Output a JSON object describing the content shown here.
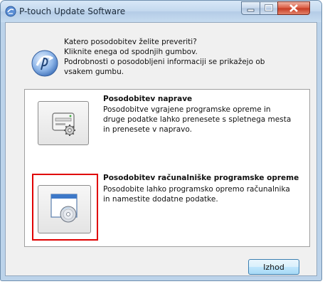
{
  "window": {
    "title": "P-touch Update Software",
    "icon": "ptouch-app-icon",
    "controls": [
      "minimize-icon",
      "maximize-icon",
      "close-icon"
    ]
  },
  "intro": {
    "icon": "ptouch-logo-icon",
    "lines": [
      "Katero posodobitev želite preveriti?",
      "Kliknite enega od spodnjih gumbov.",
      "Podrobnosti o posodobljeni informaciji se prikažejo ob",
      "vsakem gumbu."
    ]
  },
  "options": [
    {
      "title": "Posodobitev naprave",
      "icon": "printer-gear-icon",
      "description": [
        "Posodobitve vgrajene programske opreme in",
        "druge podatke lahko prenesete s spletnega mesta",
        "in prenesete v napravo."
      ]
    },
    {
      "title": "Posodobitev računalniške programske opreme",
      "icon": "window-disc-icon",
      "highlighted": true,
      "description": [
        "Posodobite lahko programsko opremo računalnika",
        "in namestite dodatne podatke."
      ]
    }
  ],
  "footer": {
    "exit_label": "Izhod"
  },
  "colors": {
    "highlight": "#e00000",
    "close_button": "#c63a22",
    "titlebar": "#c3d8ee"
  }
}
